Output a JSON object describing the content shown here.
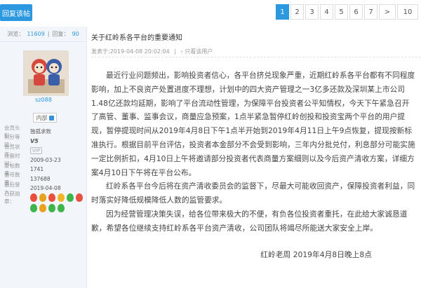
{
  "toolbar": {
    "reply_label": "回复该帖"
  },
  "pagination": {
    "pages": [
      "1",
      "2",
      "3",
      "4",
      "5",
      "6",
      "7"
    ],
    "next": ">",
    "last": "10",
    "active": "1"
  },
  "sidebar": {
    "views_label": "浏览：",
    "views": "11609",
    "replies_label": "回复：",
    "replies": "90",
    "username": "sz088",
    "badge_label": "内部",
    "fields": [
      {
        "k": "会员头衔：",
        "v": "独孤求败"
      },
      {
        "k": "积分等级：",
        "v": "V5"
      },
      {
        "k": "会员状态：",
        "v": "VIP"
      },
      {
        "k": "注册时间：",
        "v": "2009-03-23"
      },
      {
        "k": "发帖数量：",
        "v": "1741"
      },
      {
        "k": "金币数量：",
        "v": "137688"
      },
      {
        "k": "最后登入：",
        "v": "2019-04-08"
      }
    ],
    "medals_label": "已获勋章："
  },
  "post": {
    "title": "关于红岭系各平台的重要通知",
    "posted_at": "发表于:2019-04-08 20:02:04",
    "only_author": "只看该用户",
    "paragraphs": [
      "最近行业问题频出，影响投资者信心，各平台挤兑现象严重，近期红岭系各平台都有不同程度影响，加上不良资产处置进度不理想，计划中的四大资产管理之一3亿多还款及深圳某上市公司1.48亿还款均延期，影响了平台流动性管理，为保障平台投资者公平知情权，今天下午紧急召开了高管、董事、监事会议，商量应急预案，1点半紧急暂停红岭创投和投资宝两个平台的用户提现，暂停提现时间从2019年4月8日下午1点半开始到2019年4月11日上午9点恢复，提现按新标准执行。根据目前平台评估，投资者本金部分不会受到影响，三年内分批兑付，利息部分可能实施一定比例折扣，4月10日上午将邀请部分投资者代表商量方案细则以及今后资产清收方案，详细方案4月10日下午将在平台公布。",
      "红岭系各平台今后将在资产清收委员会的监督下，尽最大可能收回资产，保障投资者利益，同时落实好降低规模降低人数的监管要求。",
      "因为经营管理决策失误，给各位带来极大的不便，有负各位投资者重托，在此给大家诚恳道歉，希望各位继续支持红岭系各平台资产清收，公司团队将竭尽所能送大家安全上岸。"
    ],
    "signature": "红岭老周  2019年4月8日晚上8点"
  },
  "colors": {
    "accent": "#2b98e0",
    "level": "#f28b1a"
  }
}
